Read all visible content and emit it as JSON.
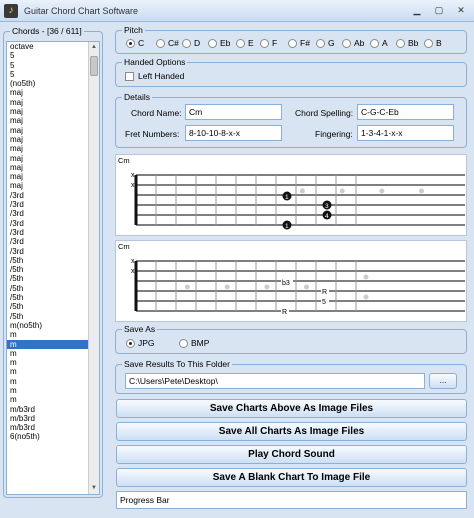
{
  "window": {
    "title": "Guitar Chord Chart Software"
  },
  "chords": {
    "title": "Chords - [36 / 611]",
    "items": [
      "octave",
      "5",
      "5",
      "5",
      "(no5th)",
      "maj",
      "maj",
      "maj",
      "maj",
      "maj",
      "maj",
      "maj",
      "maj",
      "maj",
      "maj",
      "maj",
      "/3rd",
      "/3rd",
      "/3rd",
      "/3rd",
      "/3rd",
      "/3rd",
      "/3rd",
      "/5th",
      "/5th",
      "/5th",
      "/5th",
      "/5th",
      "/5th",
      "/5th",
      "m(no5th)",
      "m",
      "m",
      "m",
      "m",
      "m",
      "m",
      "m",
      "m",
      "m/b3rd",
      "m/b3rd",
      "m/b3rd",
      "6(no5th)"
    ],
    "selected_index": 32
  },
  "pitch": {
    "title": "Pitch",
    "options": [
      "C",
      "C#",
      "D",
      "Eb",
      "E",
      "F",
      "F#",
      "G",
      "Ab",
      "A",
      "Bb",
      "B"
    ],
    "selected": "C"
  },
  "handed": {
    "title": "Handed Options",
    "left_handed_label": "Left Handed"
  },
  "details": {
    "title": "Details",
    "chord_name_label": "Chord Name:",
    "chord_name": "Cm",
    "spelling_label": "Chord Spelling:",
    "spelling": "C-G-C-Eb",
    "fret_label": "Fret Numbers:",
    "fret": "8-10-10-8-x-x",
    "fingering_label": "Fingering:",
    "fingering": "1-3-4-1-x-x"
  },
  "chart1": {
    "name": "Cm",
    "muted": [
      "x",
      "x"
    ],
    "fingers": [
      "1",
      "3",
      "4",
      "1"
    ]
  },
  "chart2": {
    "name": "Cm",
    "muted": [
      "x",
      "x"
    ],
    "notes": [
      "b3",
      "R",
      "5",
      "R"
    ]
  },
  "save_as": {
    "title": "Save As",
    "jpg": "JPG",
    "bmp": "BMP",
    "selected": "JPG"
  },
  "folder": {
    "title": "Save Results To This Folder",
    "path": "C:\\Users\\Pete\\Desktop\\",
    "browse_label": "..."
  },
  "buttons": {
    "save_above": "Save Charts Above As Image Files",
    "save_all": "Save All Charts As Image Files",
    "play": "Play Chord Sound",
    "save_blank": "Save A Blank Chart To Image File"
  },
  "progress": {
    "label": "Progress Bar"
  },
  "colors": {
    "accent": "#3173c6",
    "window_bg": "#d9e4f2",
    "border": "#8ab0d8"
  }
}
